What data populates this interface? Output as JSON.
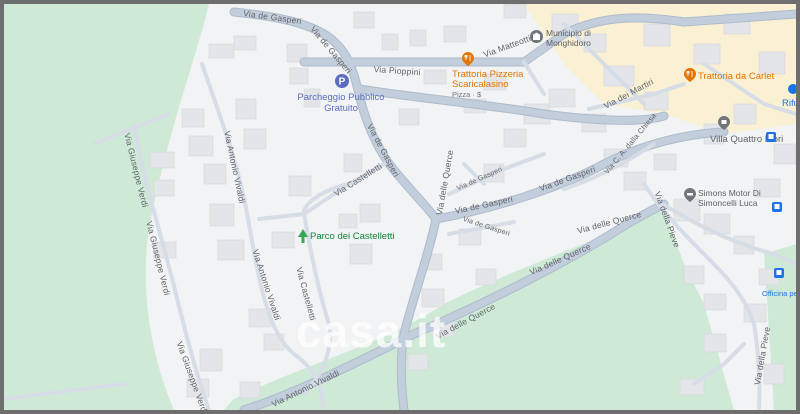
{
  "map": {
    "colors": {
      "background": "#f1f3f4",
      "park": "#ceead6",
      "road": "#c3cedc",
      "road_edge": "#aebbcc",
      "minor_road": "#d6dde6",
      "building": "#e3e5e8",
      "building_edge": "#d3d6da",
      "town_center": "#fdeec6",
      "accent_food": "#e37400",
      "accent_park": "#34a853",
      "accent_parking": "#5a6dbf"
    },
    "streets": {
      "via_de_gasperi_top": "Via de Gasperi",
      "via_de_gasperi_mid": "Via de Gasperi",
      "via_de_gasperi_lower": "Via de Gasperi",
      "via_de_gasperi_east": "Via de Gasperi",
      "via_de_gasperi_small": "Via de Gasperi",
      "via_de_gasperi_small2": "Via de Gasperi",
      "via_pioppini": "Via Pioppini",
      "via_matteotti": "Via Matteotti",
      "via_castelletti_north": "Via Castelletti",
      "via_castelletti_south": "Via Castelletti",
      "via_antonio_vivaldi_north": "Via Antonio Vivaldi",
      "via_antonio_vivaldi_mid": "Via Antonio Vivaldi",
      "via_antonio_vivaldi_south": "Via Antonio Vivaldi",
      "via_giuseppe_verdi_north": "Via Giuseppe Verdi",
      "via_giuseppe_verdi_mid": "Via Giuseppe Verdi",
      "via_giuseppe_verdi_south": "Via Giuseppe Verdi",
      "via_delle_querce_a": "Via delle Querce",
      "via_delle_querce_b": "Via delle Querce",
      "via_delle_querce_c": "Via delle Querce",
      "via_delle_querce_d": "Via delle Querce",
      "via_dei_martiri": "Via dei Martiri",
      "via_c_a_dalla_chiesa": "Via C. A. dalla Chiesa",
      "via_della_pieve_north": "Via della Pieve",
      "via_della_pieve_south": "Via della Pieve"
    },
    "pois": {
      "parking_name": "Parcheggio Pubblico Gratuito",
      "park_name": "Parco dei Castelletti",
      "municipio_name": "Municipio di Monghidoro",
      "trattoria_pizzeria_name": "Trattoria Pizzeria Scaricalasino",
      "trattoria_pizzeria_info": "Pizza · $",
      "trattoria_carlet_name": "Trattoria da Carlet",
      "villa_name": "Villa Quattro Mori",
      "simons_name": "Simons Motor Di Simoncelli Luca",
      "office_name": "Officina pe",
      "rifu_name": "Rifu"
    },
    "icons": {
      "parking": "parking-icon",
      "park": "tree-icon",
      "municipio": "city-hall-icon",
      "restaurant": "fork-knife-icon",
      "villa": "landmark-icon",
      "car_service": "car-repair-icon",
      "bus_stop": "bus-icon"
    },
    "watermark": "casa.it"
  }
}
